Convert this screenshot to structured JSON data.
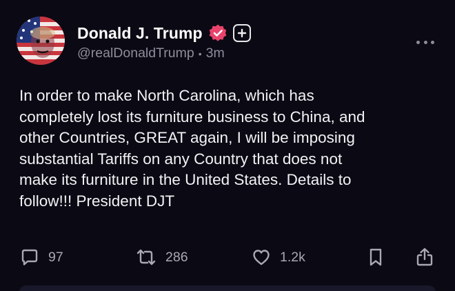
{
  "post": {
    "author": {
      "display_name": "Donald J. Trump",
      "handle": "@realDonaldTrump",
      "timestamp": "3m",
      "separator": "•",
      "verified_icon": "verified-badge-icon",
      "avatar_icon": "flag-portrait-avatar"
    },
    "follow_icon": "plus-icon",
    "more_icon": "more-horizontal-icon",
    "text": "In order to make North Carolina, which has\ncompletely lost its furniture business to China, and\nother Countries, GREAT again, I will be imposing\nsubstantial Tariffs on any Country that does not\nmake its furniture in the United States. Details to\nfollow!!! President DJT",
    "actions": {
      "reply": {
        "icon": "comment-icon",
        "count": "97"
      },
      "repost": {
        "icon": "repost-icon",
        "count": "286"
      },
      "like": {
        "icon": "heart-icon",
        "count": "1.2k"
      },
      "bookmark": {
        "icon": "bookmark-icon"
      },
      "share": {
        "icon": "share-icon"
      }
    }
  },
  "colors": {
    "background": "#0b0a14",
    "text": "#f2f2f5",
    "muted": "#8e8d99",
    "verified_badge": "#e9436b"
  }
}
